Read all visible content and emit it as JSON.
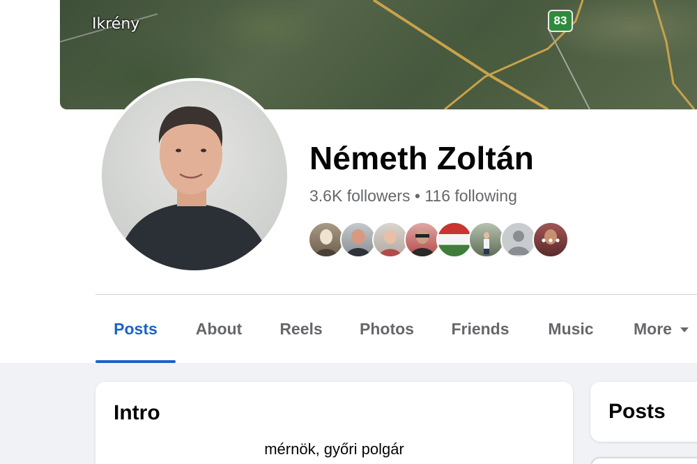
{
  "cover": {
    "place_label": "Ikrény",
    "road_number": "83"
  },
  "profile": {
    "name": "Németh Zoltán",
    "followers": "3.6K followers",
    "separator": "•",
    "following": "116 following"
  },
  "friends_preview": [
    "friend-1",
    "friend-2",
    "friend-3",
    "friend-4",
    "friend-5",
    "friend-6",
    "friend-7",
    "friend-8"
  ],
  "tabs": [
    {
      "label": "Posts",
      "active": true
    },
    {
      "label": "About"
    },
    {
      "label": "Reels"
    },
    {
      "label": "Photos"
    },
    {
      "label": "Friends"
    },
    {
      "label": "Music"
    },
    {
      "label": "More"
    }
  ],
  "intro": {
    "title": "Intro",
    "bio": "mérnök, győri polgár"
  },
  "posts_section": {
    "title": "Posts"
  },
  "colors": {
    "accent": "#1b62c9",
    "muted": "#65676b",
    "page_bg": "#f0f2f5"
  }
}
